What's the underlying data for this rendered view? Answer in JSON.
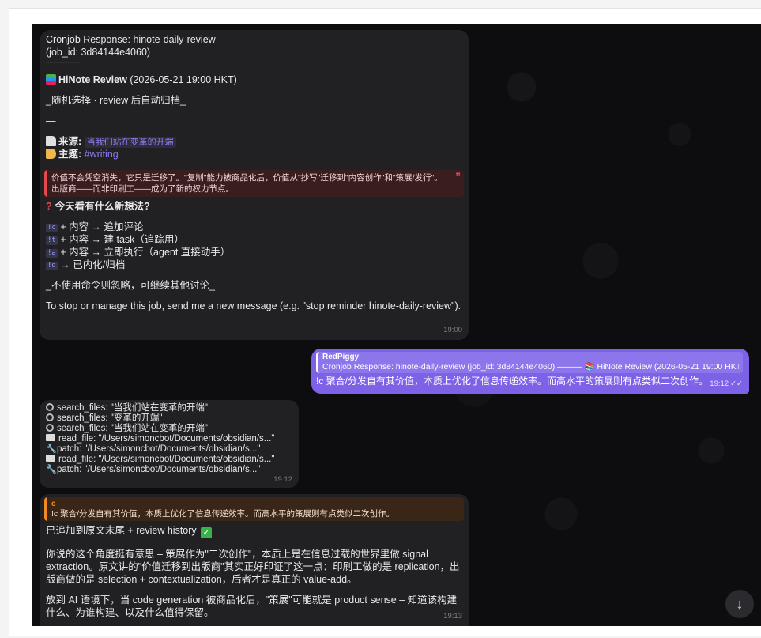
{
  "msg1": {
    "header1": "Cronjob Response: hinote-daily-review",
    "header2": "(job_id: 3d84144e4060)",
    "divider": "——————",
    "title_bold": "HiNote Review",
    "title_rest": " (2026-05-21 19:00 HKT)",
    "subtitle": "_随机选择 · review 后自动归档_",
    "rule": "—",
    "source_label": "来源:",
    "source_value": "当我们站在变革的开端",
    "topic_label": "主题:",
    "topic_value": "#writing",
    "quote": "价值不会凭空消失，它只是迁移了。\"复制\"能力被商品化后，价值从\"抄写\"迁移到\"内容创作\"和\"策展/发行\"。出版商——而非印刷工——成为了新的权力节点。",
    "question": "今天看有什么新想法?",
    "cmds": [
      {
        "code": "!c",
        "text": " + 内容 → 追加评论"
      },
      {
        "code": "!t",
        "text": " + 内容 → 建 task（追踪用）"
      },
      {
        "code": "!a",
        "text": " + 内容 → 立即执行（agent 直接动手）"
      },
      {
        "code": "!d",
        "text": " → 已内化/归档"
      }
    ],
    "footer_note": "_不使用命令则忽略，可继续其他讨论_",
    "stop_text": "To stop or manage this job, send me a new message (e.g. \"stop reminder hinote-daily-review\").",
    "time": "19:00"
  },
  "msg2": {
    "reply_name": "RedPiggy",
    "reply_text": "Cronjob Response: hinote-daily-review (job_id: 3d84144e4060) ——— 📚 HiNote Review (2026-05-21 19:00 HKT) _...",
    "text": "!c 聚合/分发自有其价值，本质上优化了信息传递效率。而高水平的策展则有点类似二次创作。",
    "time": "19:12",
    "read": "✓✓"
  },
  "msg3": {
    "lines": [
      {
        "icon": "search",
        "text": "search_files: \"当我们站在变革的开端\""
      },
      {
        "icon": "search",
        "text": "search_files: \"变革的开端\""
      },
      {
        "icon": "search",
        "text": "search_files: \"当我们站在变革的开端\""
      },
      {
        "icon": "book",
        "text": "read_file: \"/Users/simoncbot/Documents/obsidian/s...\""
      },
      {
        "icon": "wrench",
        "text": "patch: \"/Users/simoncbot/Documents/obsidian/s...\""
      },
      {
        "icon": "book",
        "text": "read_file: \"/Users/simoncbot/Documents/obsidian/s...\""
      },
      {
        "icon": "wrench",
        "text": "patch: \"/Users/simoncbot/Documents/obsidian/s...\""
      }
    ],
    "time": "19:12"
  },
  "msg4": {
    "quote_who": "c",
    "quote_text": "!c 聚合/分发自有其价值，本质上优化了信息传递效率。而高水平的策展则有点类似二次创作。",
    "added": "已追加到原文末尾 + review history",
    "para1": "你说的这个角度挺有意思 – 策展作为\"二次创作\"，本质上是在信息过载的世界里做 signal extraction。原文讲的\"价值迁移到出版商\"其实正好印证了这一点：印刷工做的是 replication，出版商做的是 selection + contextualization，后者才是真正的 value-add。",
    "para2": "放到 AI 语境下，当 code generation 被商品化后，\"策展\"可能就是 product sense – 知道该构建什么、为谁构建、以及什么值得保留。",
    "time": "19:13"
  },
  "scroll_button": "↓",
  "colors": {
    "chat_bg": "#0d0d10",
    "bubble_in": "#212124",
    "bubble_out": "#7d62e8",
    "quote_red": "#e5484d",
    "quote_orange": "#f08a24",
    "link": "#8e7cf0"
  }
}
